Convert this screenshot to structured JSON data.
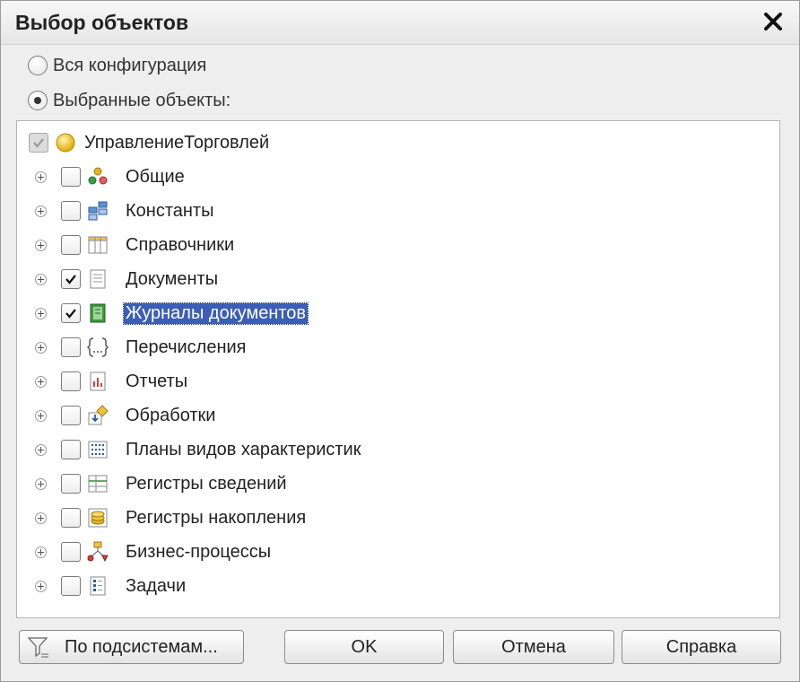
{
  "window": {
    "title": "Выбор объектов"
  },
  "radio_options": [
    {
      "label": "Вся конфигурация",
      "checked": false
    },
    {
      "label": "Выбранные объекты:",
      "checked": true
    }
  ],
  "tree": {
    "root": {
      "label": "УправлениеТорговлей",
      "icon": "configuration-icon"
    },
    "items": [
      {
        "label": "Общие",
        "checked": false,
        "icon": "common-objects-icon"
      },
      {
        "label": "Константы",
        "checked": false,
        "icon": "constants-icon"
      },
      {
        "label": "Справочники",
        "checked": false,
        "icon": "catalogs-icon"
      },
      {
        "label": "Документы",
        "checked": true,
        "icon": "documents-icon"
      },
      {
        "label": "Журналы документов",
        "checked": true,
        "selected": true,
        "icon": "document-journals-icon"
      },
      {
        "label": "Перечисления",
        "checked": false,
        "icon": "enumerations-icon"
      },
      {
        "label": "Отчеты",
        "checked": false,
        "icon": "reports-icon"
      },
      {
        "label": "Обработки",
        "checked": false,
        "icon": "data-processors-icon"
      },
      {
        "label": "Планы видов характеристик",
        "checked": false,
        "icon": "characteristic-types-icon"
      },
      {
        "label": "Регистры сведений",
        "checked": false,
        "icon": "information-registers-icon"
      },
      {
        "label": "Регистры накопления",
        "checked": false,
        "icon": "accumulation-registers-icon"
      },
      {
        "label": "Бизнес-процессы",
        "checked": false,
        "icon": "business-processes-icon"
      },
      {
        "label": "Задачи",
        "checked": false,
        "icon": "tasks-icon"
      }
    ]
  },
  "buttons": {
    "subsystems": "По подсистемам...",
    "ok": "OK",
    "cancel": "Отмена",
    "help": "Справка"
  },
  "colors": {
    "selection": "#3b5fb6",
    "window_bg": "#eeeeee",
    "tree_bg": "#ffffff"
  }
}
